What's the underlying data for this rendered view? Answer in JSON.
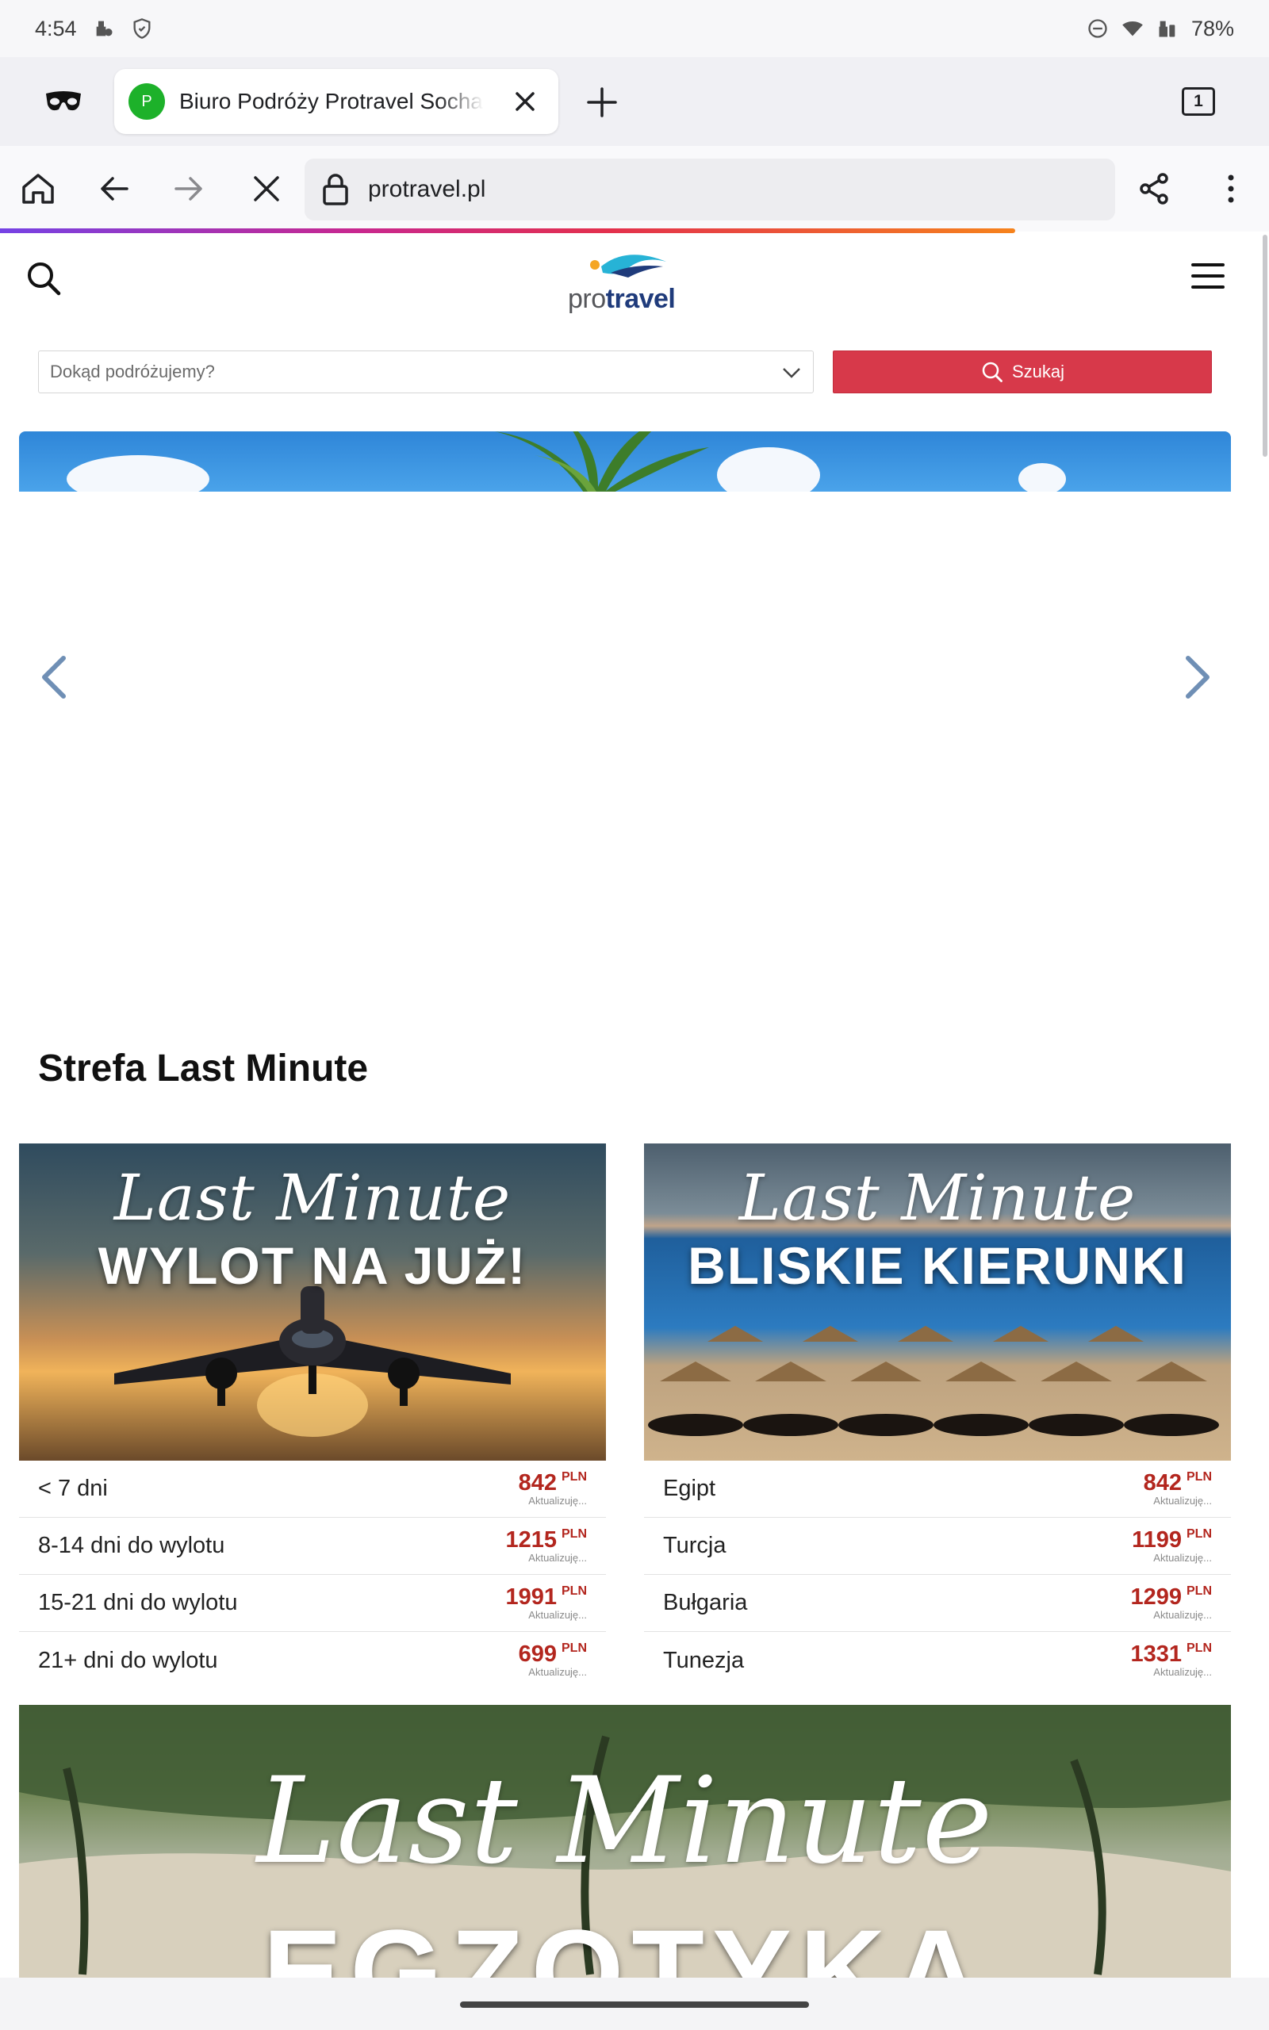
{
  "status_bar": {
    "time": "4:54",
    "battery": "78%"
  },
  "browser": {
    "tab": {
      "favicon_letter": "P",
      "title": "Biuro Podróży Protravel Sochaczew",
      "count": "1"
    },
    "url": "protravel.pl",
    "colors": {
      "favicon": "#1db12a",
      "progress_start": "#7542e5",
      "progress_end": "#f6831c"
    }
  },
  "site": {
    "logo": {
      "light": "pro",
      "bold": "travel"
    },
    "search": {
      "placeholder": "Dokąd podróżujemy?",
      "button": "Szukaj"
    },
    "section_title": "Strefa Last Minute",
    "cards": [
      {
        "script": "Last Minute",
        "headline": "WYLOT NA JUŻ!",
        "rows": [
          {
            "label": "< 7 dni",
            "price": "842",
            "currency": "PLN",
            "note": "Aktualizuję..."
          },
          {
            "label": "8-14 dni do wylotu",
            "price": "1215",
            "currency": "PLN",
            "note": "Aktualizuję..."
          },
          {
            "label": "15-21 dni do wylotu",
            "price": "1991",
            "currency": "PLN",
            "note": "Aktualizuję..."
          },
          {
            "label": "21+ dni do wylotu",
            "price": "699",
            "currency": "PLN",
            "note": "Aktualizuję..."
          }
        ]
      },
      {
        "script": "Last Minute",
        "headline": "BLISKIE KIERUNKI",
        "rows": [
          {
            "label": "Egipt",
            "price": "842",
            "currency": "PLN",
            "note": "Aktualizuję..."
          },
          {
            "label": "Turcja",
            "price": "1199",
            "currency": "PLN",
            "note": "Aktualizuję..."
          },
          {
            "label": "Bułgaria",
            "price": "1299",
            "currency": "PLN",
            "note": "Aktualizuję..."
          },
          {
            "label": "Tunezja",
            "price": "1331",
            "currency": "PLN",
            "note": "Aktualizuję..."
          }
        ]
      }
    ],
    "banner": {
      "script": "Last Minute",
      "headline": "EGZOTYKA"
    },
    "colors": {
      "accent_red": "#d7394a",
      "price_red": "#b3261e",
      "logo_blue": "#1f3b7b"
    }
  }
}
